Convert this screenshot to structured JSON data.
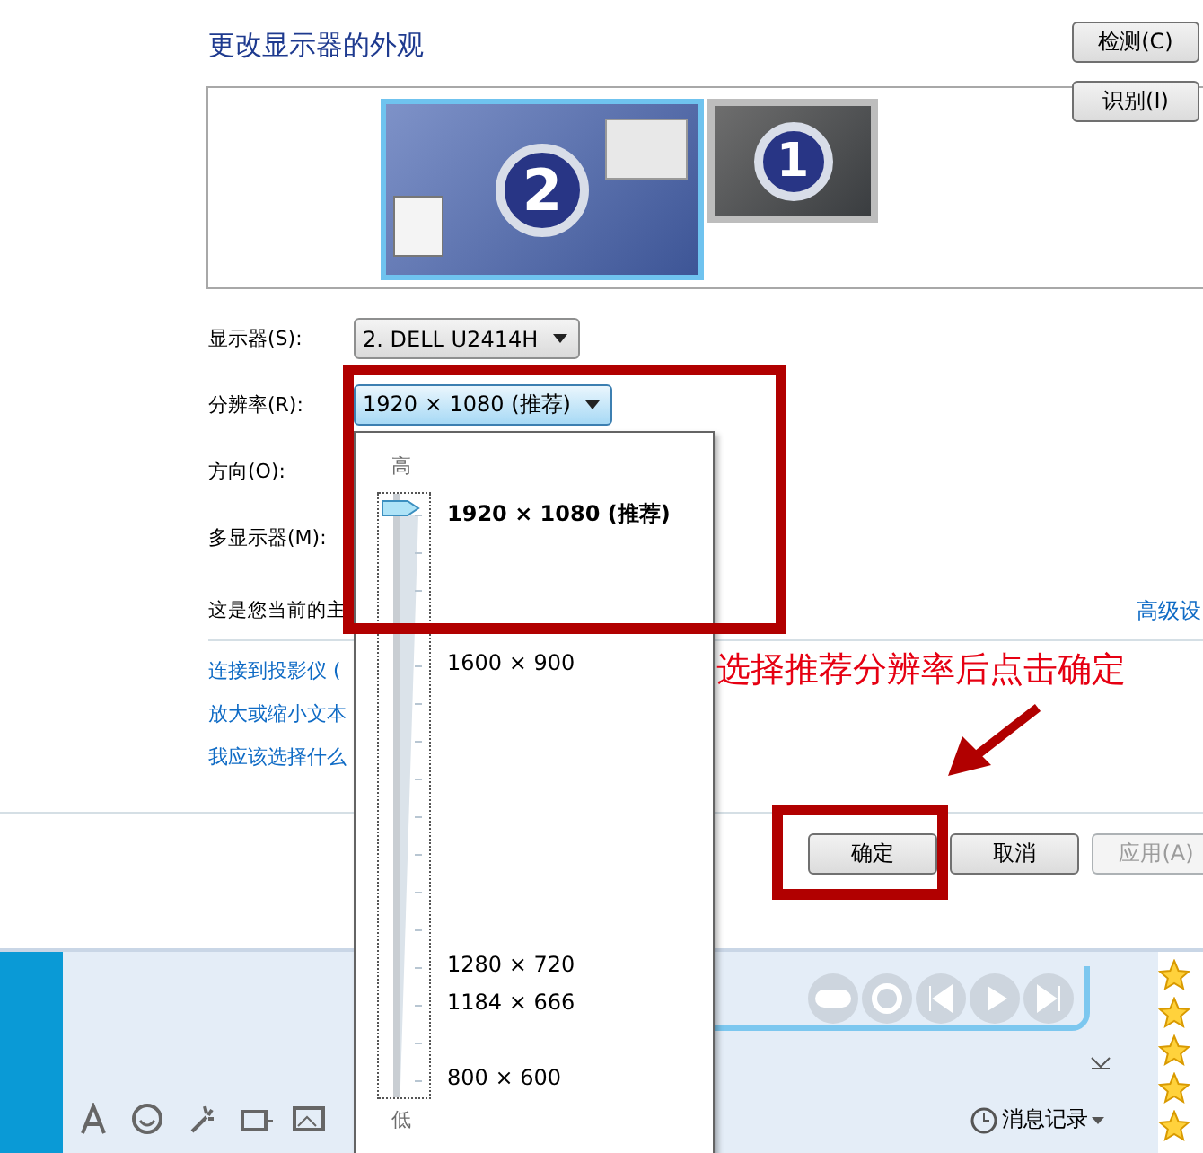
{
  "dialog": {
    "title": "更改显示器的外观",
    "monitors": [
      {
        "label": "2",
        "selected": true
      },
      {
        "label": "1",
        "selected": false
      }
    ],
    "side_buttons": [
      "检测(C)",
      "识别(I)"
    ],
    "fields": [
      {
        "label": "显示器(S):",
        "value": "2. DELL U2414H",
        "expanded": false
      },
      {
        "label": "分辨率(R):",
        "value": "1920 × 1080 (推荐)",
        "expanded": true
      },
      {
        "label": "方向(O):"
      },
      {
        "label": "多显示器(M):"
      }
    ],
    "note": "这是您当前的主",
    "advanced_link": "高级设",
    "links": [
      "连接到投影仪 (",
      "放大或缩小文本",
      "我应该选择什么"
    ],
    "buttons": [
      {
        "label": "确定",
        "disabled": false
      },
      {
        "label": "取消",
        "disabled": false
      },
      {
        "label": "应用(A)",
        "disabled": true
      }
    ]
  },
  "resolution_popup": {
    "high_label": "高",
    "low_label": "低",
    "level": 1,
    "options": [
      {
        "label": "1920 × 1080 (推荐)",
        "selected": true
      },
      {
        "label": "1600 × 900",
        "selected": false
      },
      {
        "label": "1280 × 720",
        "selected": false
      },
      {
        "label": "1184 × 666",
        "selected": false
      },
      {
        "label": "800 × 600",
        "selected": false
      }
    ]
  },
  "annotation": {
    "text": "选择推荐分辨率后点击确定"
  },
  "chat": {
    "history_label": "消息记录"
  }
}
